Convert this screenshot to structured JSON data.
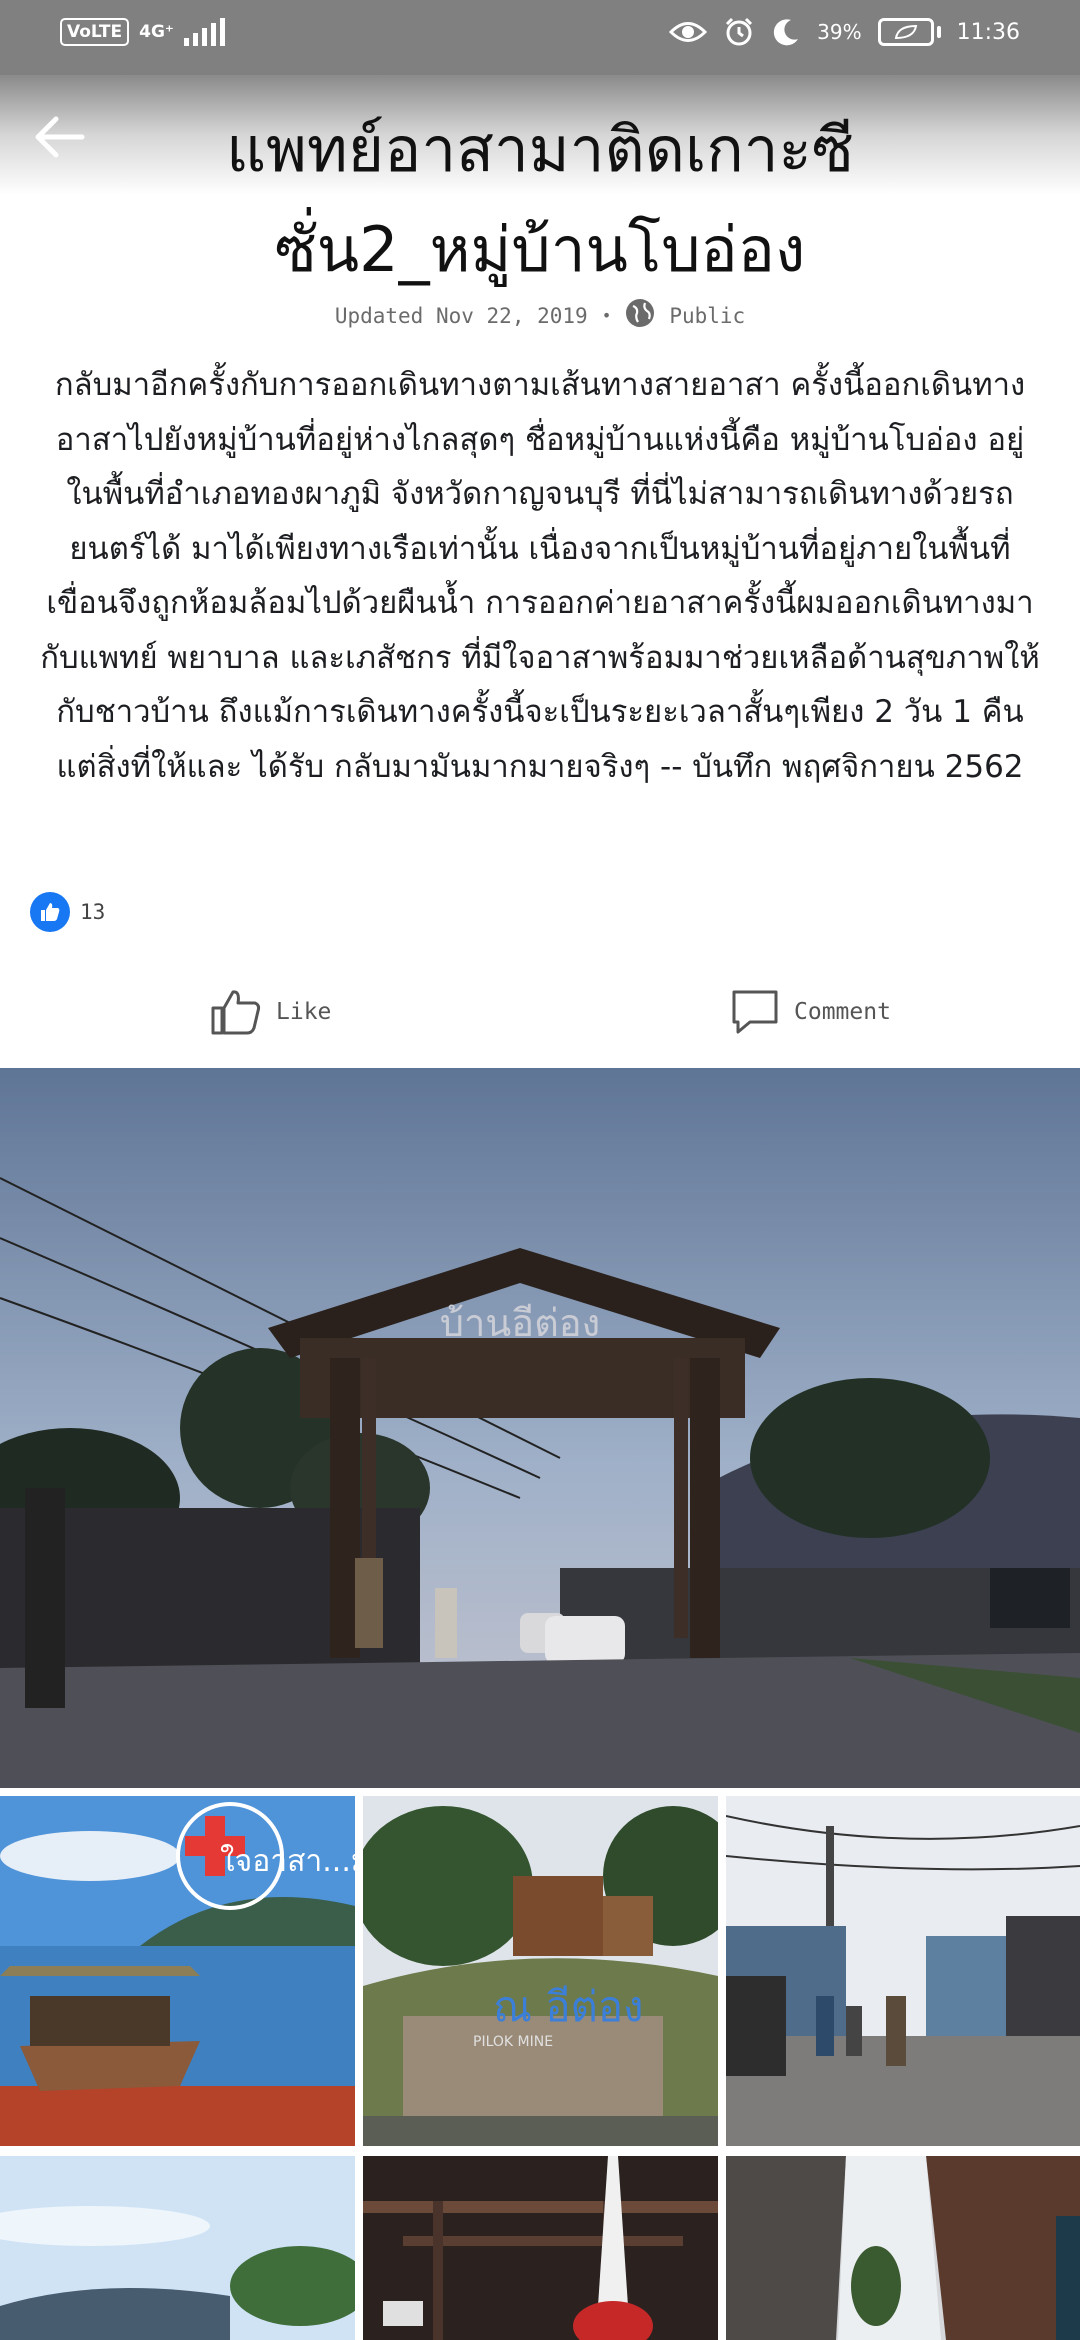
{
  "status_bar": {
    "volte": "VoLTE",
    "network": "4G⁺",
    "battery": "39%",
    "time": "11:36",
    "icons": [
      "eye-comfort-icon",
      "alarm-icon",
      "moon-icon",
      "battery-saver-icon"
    ]
  },
  "header": {
    "back_icon": "arrow-left-icon"
  },
  "post": {
    "title": "แพทย์อาสามาติดเกาะซีซั่น2_หมู่บ้านโบอ่อง",
    "updated": "Updated Nov 22, 2019",
    "separator": "•",
    "privacy": "Public",
    "body": "กลับมาอีกครั้งกับการออกเดินทางตามเส้นทางสายอาสา ครั้งนี้ออกเดินทางอาสาไปยังหมู่บ้านที่อยู่ห่างไกลสุดๆ ชื่อหมู่บ้านแห่งนี้คือ หมู่บ้านโบอ่อง อยู่ในพื้นที่อำเภอทองผาภูมิ จังหวัดกาญจนบุรี ที่นี่ไม่สามารถเดินทางด้วยรถยนตร์ได้ มาได้เพียงทางเรือเท่านั้น เนื่องจากเป็นหมู่บ้านที่อยู่ภายในพื้นที่เขื่อนจึงถูกห้อมล้อมไปด้วยผืนน้ำ การออกค่ายอาสาครั้งนี้ผมออกเดินทางมากับแพทย์ พยาบาล และเภสัชกร ที่มีใจอาสาพร้อมมาช่วยเหลือด้านสุขภาพให้กับชาวบ้าน ถึงแม้การเดินทางครั้งนี้จะเป็นระยะเวลาสั้นๆเพียง 2 วัน 1 คืน แต่สิ่งที่ให้และ ได้รับ กลับมามันมากมายจริงๆ -- บันทึก พฤศจิกายน 2562",
    "reaction_count": "13",
    "like_label": "Like",
    "comment_label": "Comment"
  },
  "photos": {
    "main_sign_text": "บ้านอีต่อง",
    "thumb1_text": "ใจอาสา...มาก",
    "thumb2_text": "ณ อีต่อง",
    "thumb2_sub": "PILOK MINE"
  },
  "colors": {
    "status_bar": "#808080",
    "accent": "#1877f2",
    "text": "#1c1e21",
    "meta": "#6b6b6b"
  }
}
